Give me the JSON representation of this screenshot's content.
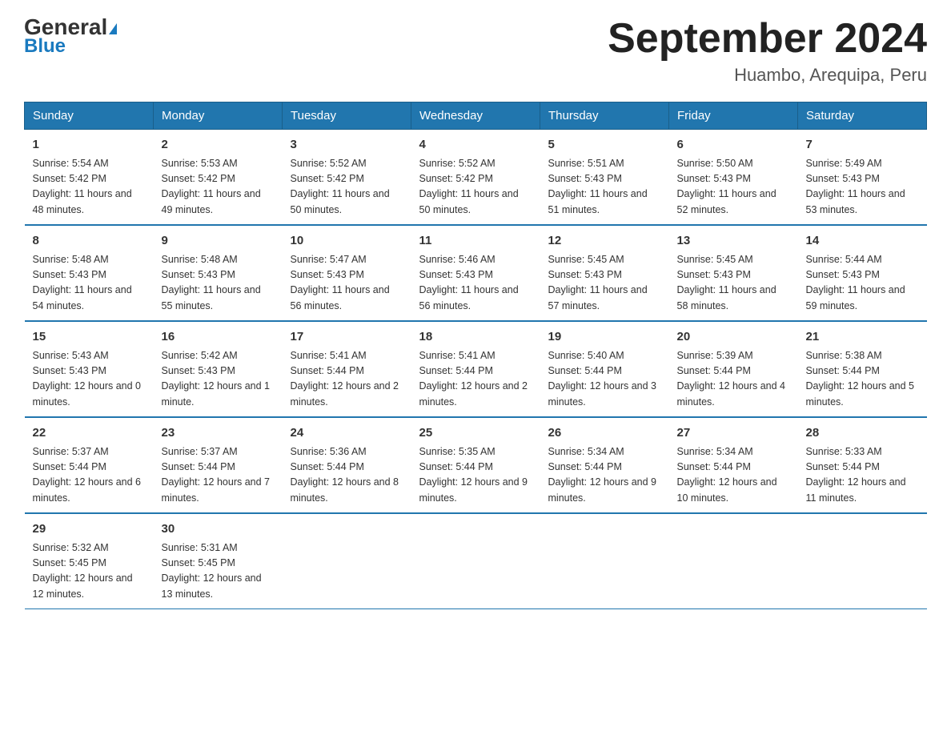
{
  "header": {
    "logo_general": "General",
    "logo_blue": "Blue",
    "title": "September 2024",
    "subtitle": "Huambo, Arequipa, Peru"
  },
  "days_of_week": [
    "Sunday",
    "Monday",
    "Tuesday",
    "Wednesday",
    "Thursday",
    "Friday",
    "Saturday"
  ],
  "weeks": [
    [
      {
        "day": "1",
        "sunrise": "Sunrise: 5:54 AM",
        "sunset": "Sunset: 5:42 PM",
        "daylight": "Daylight: 11 hours and 48 minutes."
      },
      {
        "day": "2",
        "sunrise": "Sunrise: 5:53 AM",
        "sunset": "Sunset: 5:42 PM",
        "daylight": "Daylight: 11 hours and 49 minutes."
      },
      {
        "day": "3",
        "sunrise": "Sunrise: 5:52 AM",
        "sunset": "Sunset: 5:42 PM",
        "daylight": "Daylight: 11 hours and 50 minutes."
      },
      {
        "day": "4",
        "sunrise": "Sunrise: 5:52 AM",
        "sunset": "Sunset: 5:42 PM",
        "daylight": "Daylight: 11 hours and 50 minutes."
      },
      {
        "day": "5",
        "sunrise": "Sunrise: 5:51 AM",
        "sunset": "Sunset: 5:43 PM",
        "daylight": "Daylight: 11 hours and 51 minutes."
      },
      {
        "day": "6",
        "sunrise": "Sunrise: 5:50 AM",
        "sunset": "Sunset: 5:43 PM",
        "daylight": "Daylight: 11 hours and 52 minutes."
      },
      {
        "day": "7",
        "sunrise": "Sunrise: 5:49 AM",
        "sunset": "Sunset: 5:43 PM",
        "daylight": "Daylight: 11 hours and 53 minutes."
      }
    ],
    [
      {
        "day": "8",
        "sunrise": "Sunrise: 5:48 AM",
        "sunset": "Sunset: 5:43 PM",
        "daylight": "Daylight: 11 hours and 54 minutes."
      },
      {
        "day": "9",
        "sunrise": "Sunrise: 5:48 AM",
        "sunset": "Sunset: 5:43 PM",
        "daylight": "Daylight: 11 hours and 55 minutes."
      },
      {
        "day": "10",
        "sunrise": "Sunrise: 5:47 AM",
        "sunset": "Sunset: 5:43 PM",
        "daylight": "Daylight: 11 hours and 56 minutes."
      },
      {
        "day": "11",
        "sunrise": "Sunrise: 5:46 AM",
        "sunset": "Sunset: 5:43 PM",
        "daylight": "Daylight: 11 hours and 56 minutes."
      },
      {
        "day": "12",
        "sunrise": "Sunrise: 5:45 AM",
        "sunset": "Sunset: 5:43 PM",
        "daylight": "Daylight: 11 hours and 57 minutes."
      },
      {
        "day": "13",
        "sunrise": "Sunrise: 5:45 AM",
        "sunset": "Sunset: 5:43 PM",
        "daylight": "Daylight: 11 hours and 58 minutes."
      },
      {
        "day": "14",
        "sunrise": "Sunrise: 5:44 AM",
        "sunset": "Sunset: 5:43 PM",
        "daylight": "Daylight: 11 hours and 59 minutes."
      }
    ],
    [
      {
        "day": "15",
        "sunrise": "Sunrise: 5:43 AM",
        "sunset": "Sunset: 5:43 PM",
        "daylight": "Daylight: 12 hours and 0 minutes."
      },
      {
        "day": "16",
        "sunrise": "Sunrise: 5:42 AM",
        "sunset": "Sunset: 5:43 PM",
        "daylight": "Daylight: 12 hours and 1 minute."
      },
      {
        "day": "17",
        "sunrise": "Sunrise: 5:41 AM",
        "sunset": "Sunset: 5:44 PM",
        "daylight": "Daylight: 12 hours and 2 minutes."
      },
      {
        "day": "18",
        "sunrise": "Sunrise: 5:41 AM",
        "sunset": "Sunset: 5:44 PM",
        "daylight": "Daylight: 12 hours and 2 minutes."
      },
      {
        "day": "19",
        "sunrise": "Sunrise: 5:40 AM",
        "sunset": "Sunset: 5:44 PM",
        "daylight": "Daylight: 12 hours and 3 minutes."
      },
      {
        "day": "20",
        "sunrise": "Sunrise: 5:39 AM",
        "sunset": "Sunset: 5:44 PM",
        "daylight": "Daylight: 12 hours and 4 minutes."
      },
      {
        "day": "21",
        "sunrise": "Sunrise: 5:38 AM",
        "sunset": "Sunset: 5:44 PM",
        "daylight": "Daylight: 12 hours and 5 minutes."
      }
    ],
    [
      {
        "day": "22",
        "sunrise": "Sunrise: 5:37 AM",
        "sunset": "Sunset: 5:44 PM",
        "daylight": "Daylight: 12 hours and 6 minutes."
      },
      {
        "day": "23",
        "sunrise": "Sunrise: 5:37 AM",
        "sunset": "Sunset: 5:44 PM",
        "daylight": "Daylight: 12 hours and 7 minutes."
      },
      {
        "day": "24",
        "sunrise": "Sunrise: 5:36 AM",
        "sunset": "Sunset: 5:44 PM",
        "daylight": "Daylight: 12 hours and 8 minutes."
      },
      {
        "day": "25",
        "sunrise": "Sunrise: 5:35 AM",
        "sunset": "Sunset: 5:44 PM",
        "daylight": "Daylight: 12 hours and 9 minutes."
      },
      {
        "day": "26",
        "sunrise": "Sunrise: 5:34 AM",
        "sunset": "Sunset: 5:44 PM",
        "daylight": "Daylight: 12 hours and 9 minutes."
      },
      {
        "day": "27",
        "sunrise": "Sunrise: 5:34 AM",
        "sunset": "Sunset: 5:44 PM",
        "daylight": "Daylight: 12 hours and 10 minutes."
      },
      {
        "day": "28",
        "sunrise": "Sunrise: 5:33 AM",
        "sunset": "Sunset: 5:44 PM",
        "daylight": "Daylight: 12 hours and 11 minutes."
      }
    ],
    [
      {
        "day": "29",
        "sunrise": "Sunrise: 5:32 AM",
        "sunset": "Sunset: 5:45 PM",
        "daylight": "Daylight: 12 hours and 12 minutes."
      },
      {
        "day": "30",
        "sunrise": "Sunrise: 5:31 AM",
        "sunset": "Sunset: 5:45 PM",
        "daylight": "Daylight: 12 hours and 13 minutes."
      },
      {
        "day": "",
        "sunrise": "",
        "sunset": "",
        "daylight": ""
      },
      {
        "day": "",
        "sunrise": "",
        "sunset": "",
        "daylight": ""
      },
      {
        "day": "",
        "sunrise": "",
        "sunset": "",
        "daylight": ""
      },
      {
        "day": "",
        "sunrise": "",
        "sunset": "",
        "daylight": ""
      },
      {
        "day": "",
        "sunrise": "",
        "sunset": "",
        "daylight": ""
      }
    ]
  ]
}
